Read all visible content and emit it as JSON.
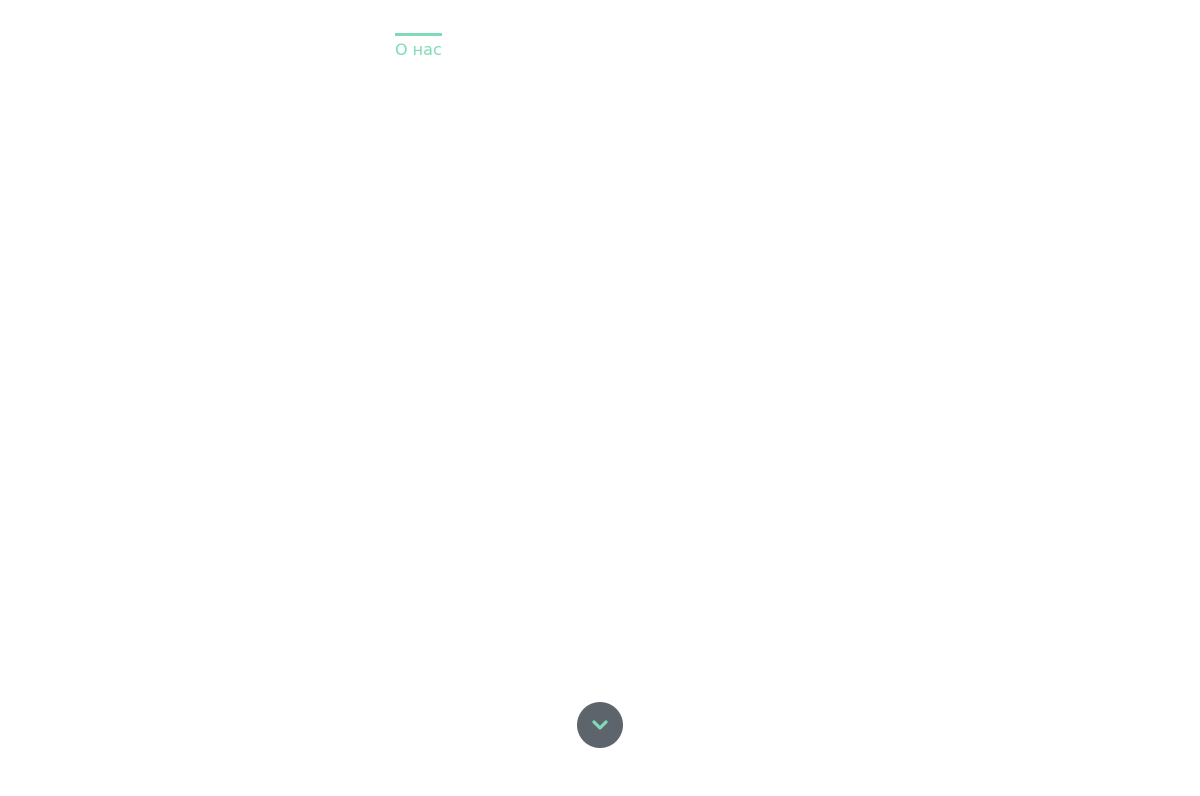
{
  "nav": {
    "items": [
      {
        "label": "О нас",
        "active": true
      }
    ]
  },
  "scroll_button": {
    "icon": "chevron-down-icon"
  },
  "colors": {
    "accent": "#7fdbb6",
    "button_bg": "#5d646c",
    "background": "#ffffff"
  }
}
